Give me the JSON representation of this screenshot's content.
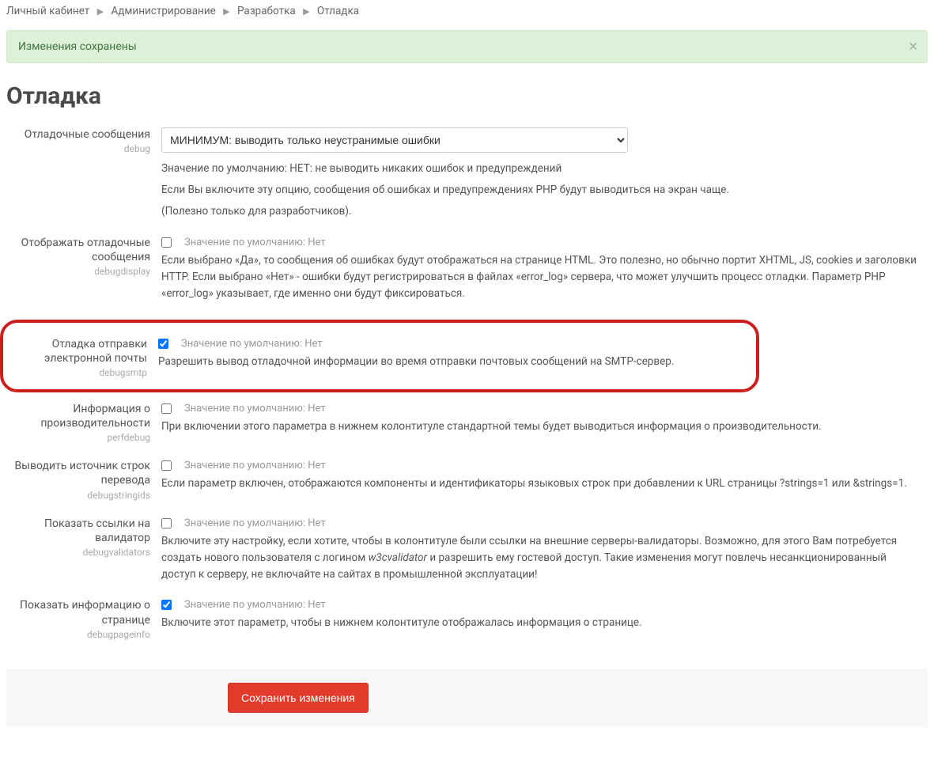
{
  "breadcrumb": {
    "items": [
      "Личный кабинет",
      "Администрирование",
      "Разработка",
      "Отладка"
    ]
  },
  "alert": {
    "text": "Изменения сохранены"
  },
  "title": "Отладка",
  "rows": {
    "debug": {
      "label": "Отладочные сообщения",
      "key": "debug",
      "selected": "МИНИМУМ: выводить только неустранимые ошибки",
      "hint": "Значение по умолчанию: НЕТ: не выводить никаких ошибок и предупреждений",
      "desc1": "Если Вы включите эту опцию, сообщения об ошибках и предупреждениях PHP будут выводиться на экран чаще.",
      "desc2": "(Полезно только для разработчиков)."
    },
    "debugdisplay": {
      "label": "Отображать отладочные сообщения",
      "key": "debugdisplay",
      "checked": false,
      "hint": "Значение по умолчанию: Нет",
      "desc": "Если выбрано «Да», то сообщения об ошибках будут отображаться на странице HTML. Это полезно, но обычно портит XHTML, JS, cookies и заголовки HTTP. Если выбрано «Нет» - ошибки будут регистрироваться в файлах «error_log» сервера, что может улучшить процесс отладки. Параметр PHP «error_log» указывает, где именно они будут фиксироваться."
    },
    "debugsmtp": {
      "label": "Отладка отправки электронной почты",
      "key": "debugsmtp",
      "checked": true,
      "hint": "Значение по умолчанию: Нет",
      "desc": "Разрешить вывод отладочной информации во время отправки почтовых сообщений на SMTP-сервер."
    },
    "perfdebug": {
      "label": "Информация о производительности",
      "key": "perfdebug",
      "checked": false,
      "hint": "Значение по умолчанию: Нет",
      "desc": "При включении этого параметра в нижнем колонтитуле стандартной темы будет выводиться информация о производительности."
    },
    "debugstringids": {
      "label": "Выводить источник строк перевода",
      "key": "debugstringids",
      "checked": false,
      "hint": "Значение по умолчанию: Нет",
      "desc": "Если параметр включен, отображаются компоненты и идентификаторы языковых строк при добавлении к URL страницы ?strings=1 или &strings=1."
    },
    "debugvalidators": {
      "label": "Показать ссылки на валидатор",
      "key": "debugvalidators",
      "checked": false,
      "hint": "Значение по умолчанию: Нет",
      "desc_pre": "Включите эту настройку, если хотите, чтобы в колонтитуле были ссылки на внешние серверы-валидаторы. Возможно, для этого Вам потребуется создать нового пользователя с логином ",
      "desc_em": "w3cvalidator",
      "desc_post": " и разрешить ему гостевой доступ. Такие изменения могут повлечь несанкционированный доступ к серверу, не включайте на сайтах в промышленной эксплуатации!"
    },
    "debugpageinfo": {
      "label": "Показать информацию о странице",
      "key": "debugpageinfo",
      "checked": true,
      "hint": "Значение по умолчанию: Нет",
      "desc": "Включите этот параметр, чтобы в нижнем колонтитуле отображалась информация о странице."
    }
  },
  "footer": {
    "save": "Сохранить изменения"
  }
}
